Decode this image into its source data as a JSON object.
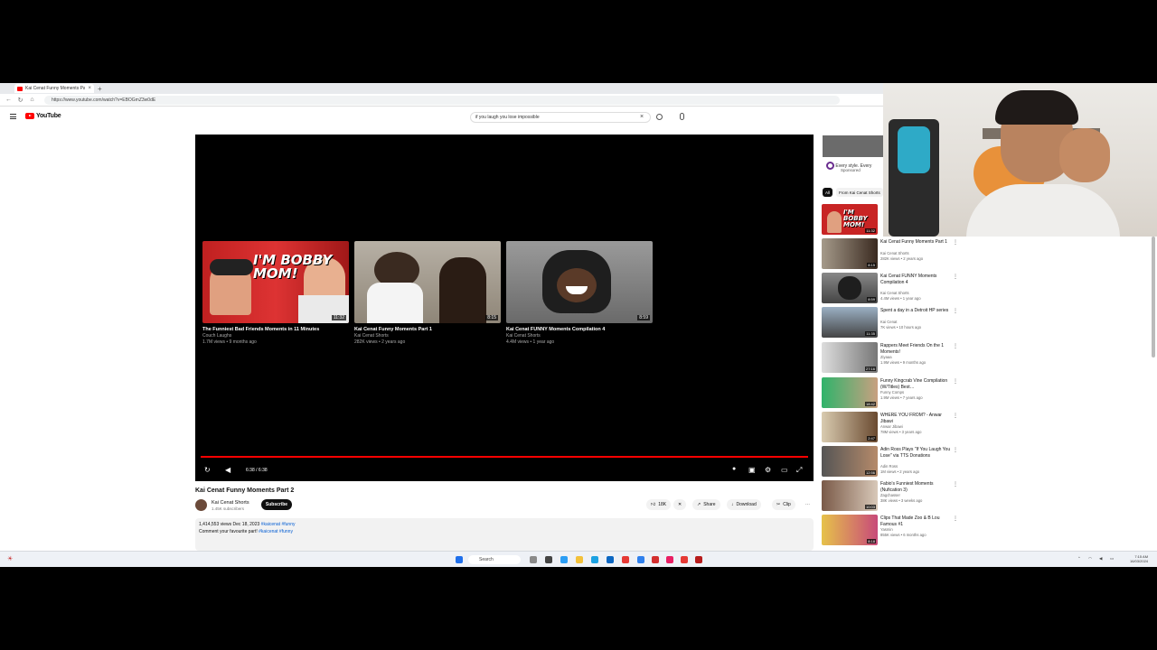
{
  "browser": {
    "tab_title": "Kai Cenat Funny Moments Pa",
    "url": "https://www.youtube.com/watch?v=EBOGmZ3w0dE"
  },
  "youtube": {
    "logo_text": "YouTube",
    "search_value": "if you laugh you lose impossible",
    "video": {
      "title": "Kai Cenat Funny Moments Part 2",
      "channel": "Kai Cenat Shorts",
      "subscribers": "1.45K subscribers",
      "subscribe_label": "Subscribe",
      "time": "6:38 / 6:38",
      "progress": 1.0,
      "likes": "18K",
      "share_label": "Share",
      "download_label": "Download",
      "clip_label": "Clip",
      "desc_line1_prefix": "1,414,553 views  Dec 18, 2023",
      "desc_line1_tags": "#kaicenat #funny",
      "desc_line2_prefix": "Comment your favourite part!",
      "desc_line2_tags": "#kaicenat #funny"
    },
    "endscreen": [
      {
        "title": "The Funniest Bad Friends Moments in 11 Minutes",
        "channel": "Couch Laughs",
        "meta": "1.7M views • 9 months ago",
        "duration": "11:32",
        "overlay": "I'M BOBBY MOM!"
      },
      {
        "title": "Kai Cenat Funny Moments Part 1",
        "channel": "Kai Cenat Shorts",
        "meta": "282K views • 2 years ago",
        "duration": "8:15"
      },
      {
        "title": "Kai Cenat FUNNY Moments Compilation 4",
        "channel": "Kai Cenat Shorts",
        "meta": "4.4M views • 1 year ago",
        "duration": "8:59"
      }
    ],
    "sidebar": {
      "ad_title": "Every style. Every",
      "ad_sponsored": "Sponsored",
      "chips": [
        "All",
        "From Kai Cenat Shorts"
      ],
      "items": [
        {
          "title": "",
          "channel": "",
          "meta": "",
          "duration": "11:32"
        },
        {
          "title": "Kai Cenat Funny Moments Part 1",
          "channel": "Kai Cenat Shorts",
          "meta": "282K views • 2 years ago",
          "duration": "8:15"
        },
        {
          "title": "Kai Cenat FUNNY Moments Compilation 4",
          "channel": "Kai Cenat Shorts",
          "meta": "4.4M views • 1 year ago",
          "duration": "8:59"
        },
        {
          "title": "Spent a day in a Detroit HP series",
          "channel": "Kai Cenat",
          "meta": "7K views • 10 hours ago",
          "duration": "11:35"
        },
        {
          "title": "Rappers Meet Friends On the 1 Moments!",
          "channel": "Ziyaaa",
          "meta": "1.9M views • 9 months ago",
          "duration": "27:16"
        },
        {
          "title": "Funny Kingcrab Vine Compilation (W/Titles) Best…",
          "channel": "Funny Comps",
          "meta": "1.9M views • 7 years ago",
          "duration": "18:42"
        },
        {
          "title": "WHERE YOU FROM? - Anwar Jibawi",
          "channel": "Anwar Jibawi",
          "meta": "78M views • 3 years ago",
          "duration": "2:47"
        },
        {
          "title": "Adin Ross Plays \"If You Laugh You Lose\" via TTS Donations",
          "channel": "Adin Ross",
          "meta": "1M views • 2 years ago",
          "duration": "12:56"
        },
        {
          "title": "Fabio's Funniest Moments (Nufication 3)",
          "channel": "Zagchasser",
          "meta": "38K views • 3 weeks ago",
          "duration": "10:03"
        },
        {
          "title": "Clips That Made Zoo & B Lou Famous #1",
          "channel": "Yasmin",
          "meta": "855K views • 6 months ago",
          "duration": "8:18"
        }
      ]
    }
  },
  "taskbar": {
    "search_label": "Search",
    "time": "7:15 AM",
    "date": "16/03/2024"
  }
}
